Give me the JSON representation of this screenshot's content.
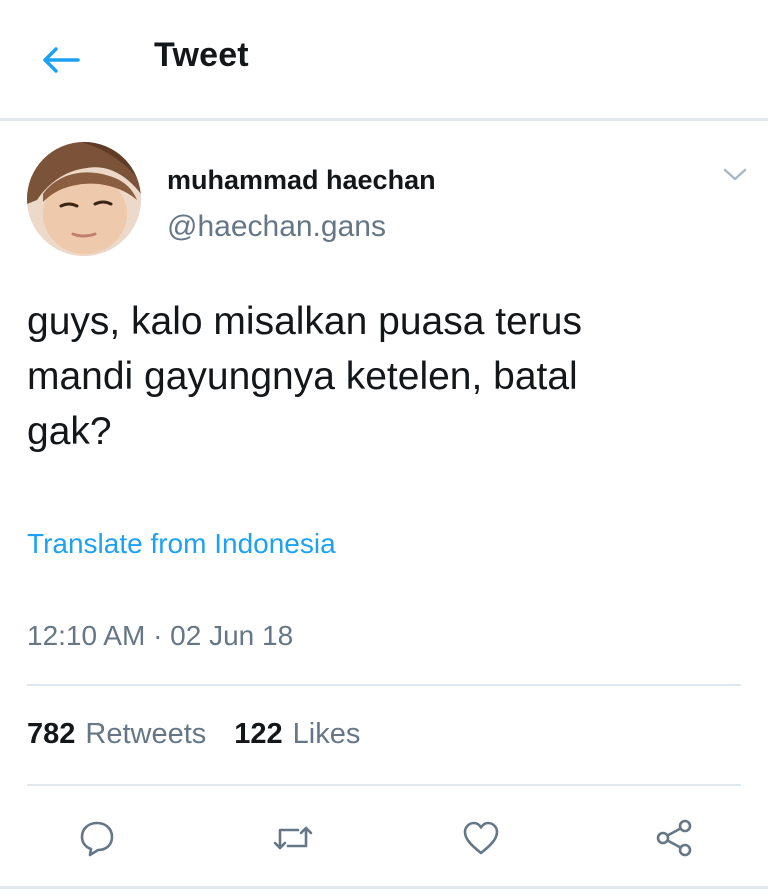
{
  "header": {
    "title": "Tweet",
    "back_icon": "arrow-left-icon"
  },
  "colors": {
    "accent": "#1da1f2",
    "text": "#14171a",
    "muted": "#657786",
    "divider": "#e1e8ed"
  },
  "tweet": {
    "author": {
      "display_name": "muhammad haechan",
      "handle": "@haechan.gans"
    },
    "text": "guys, kalo misalkan puasa terus\nmandi gayungnya ketelen, batal\ngak?",
    "translate_label": "Translate from Indonesia",
    "timestamp": "12:10 AM · 02 Jun 18",
    "stats": {
      "retweets_count": "782",
      "retweets_label": "Retweets",
      "likes_count": "122",
      "likes_label": "Likes"
    },
    "actions": [
      {
        "icon": "reply-icon"
      },
      {
        "icon": "retweet-icon"
      },
      {
        "icon": "heart-icon"
      },
      {
        "icon": "share-icon"
      }
    ]
  }
}
